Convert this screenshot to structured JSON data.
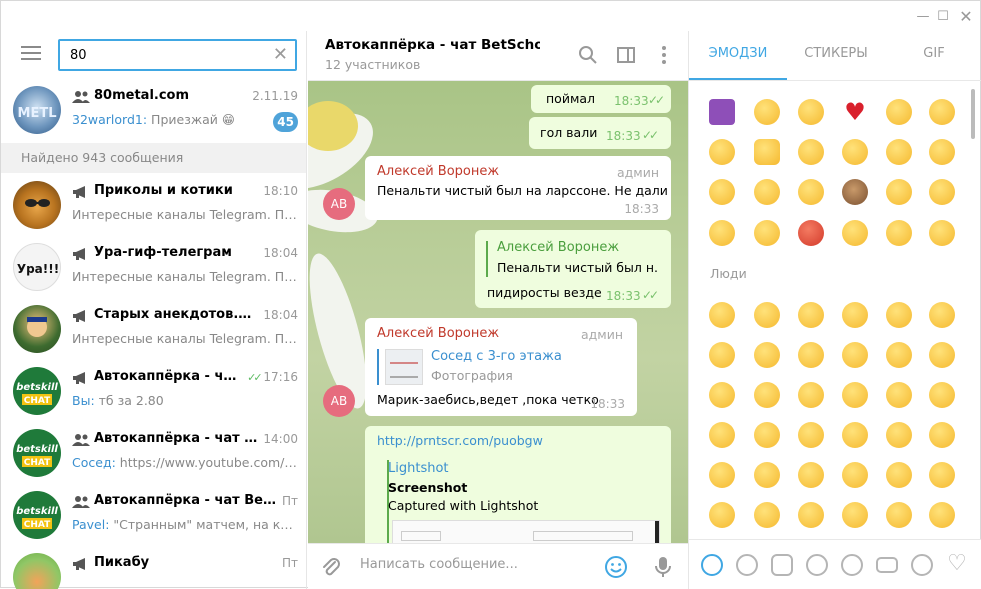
{
  "search": {
    "value": "80"
  },
  "found_label": "Найдено 943 сообщения",
  "chats": [
    {
      "name": "80metal.com",
      "time": "2.11.19",
      "sender": "32warlord1:",
      "message": " Приезжай 😁",
      "badge": "45",
      "type": "group"
    },
    {
      "name": "Приколы и котики",
      "time": "18:10",
      "sender": "",
      "message": "Интересные каналы Telegram. Под...",
      "type": "channel"
    },
    {
      "name": "Ура-гиф-телеграм",
      "time": "18:04",
      "sender": "",
      "message": "Интересные каналы Telegram. Под...",
      "type": "channel"
    },
    {
      "name": "Старых анекдотов. net",
      "time": "18:04",
      "sender": "",
      "message": "Интересные каналы Telegram. Под...",
      "type": "channel"
    },
    {
      "name": "Автокаппёрка - чат ...",
      "time": "17:16",
      "sender": "Вы:",
      "message": " тб за 2.80",
      "type": "channel"
    },
    {
      "name": "Автокаппёрка - чат Bet...",
      "time": "14:00",
      "sender": "Сосед:",
      "message": " https://www.youtube.com/w...",
      "type": "group"
    },
    {
      "name": "Автокаппёрка - чат BetSch...",
      "time": "Пт",
      "sender": "Pavel:",
      "message": " \"Странным\" матчем, на кото...",
      "type": "group"
    },
    {
      "name": "Пикабу",
      "time": "Пт",
      "sender": "",
      "message": "",
      "type": "channel"
    }
  ],
  "avatars": {
    "betskill_top": "betskill",
    "betskill_bottom": "CHAT"
  },
  "chat_header": {
    "title": "Автокаппёрка - чат BetSchool...",
    "subtitle": "12 участников"
  },
  "messages": {
    "m1": {
      "text": "поймал",
      "time": "18:33"
    },
    "m2": {
      "text": "гол вали",
      "time": "18:33"
    },
    "m3": {
      "author": "Алексей Воронеж",
      "role": "админ",
      "text": "Пенальти чистый был на ларссоне. Не дали",
      "time": "18:33",
      "avatar": "АВ"
    },
    "m4": {
      "reply_author": "Алексей Воронеж",
      "reply_text": "Пенальти чистый был н...",
      "text": "пидиросты везде",
      "time": "18:33"
    },
    "m5": {
      "author": "Алексей Воронеж",
      "role": "админ",
      "reply_title": "Сосед с 3-го этажа",
      "reply_text": "Фотография",
      "text": "Марик-заебись,ведет ,пока четко",
      "time": "18:33",
      "avatar": "АВ"
    },
    "m6": {
      "link": "http://prntscr.com/puobgw",
      "site": "Lightshot",
      "title": "Screenshot",
      "desc": "Captured with Lightshot"
    }
  },
  "composer": {
    "placeholder": "Написать сообщение..."
  },
  "emoji_tabs": [
    "ЭМОДЗИ",
    "СТИКЕРЫ",
    "GIF"
  ],
  "emoji_section": "Люди",
  "colors": {
    "accent": "#40a7e3",
    "outgoing": "#effdde",
    "author": "#c0392b",
    "avatar_bg": "#e66c7e"
  }
}
